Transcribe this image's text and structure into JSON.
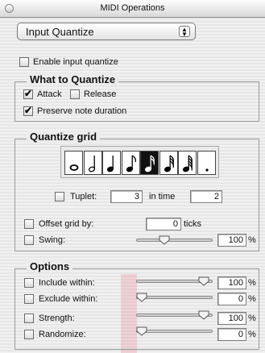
{
  "window": {
    "title": "MIDI Operations"
  },
  "mode_popup": {
    "value": "Input Quantize"
  },
  "enable": {
    "label": "Enable input quantize",
    "checked": false
  },
  "what_to_quantize": {
    "title": "What to Quantize",
    "attack": {
      "label": "Attack",
      "checked": true
    },
    "release": {
      "label": "Release",
      "checked": false
    },
    "preserve": {
      "label": "Preserve note duration",
      "checked": true
    }
  },
  "quantize_grid": {
    "title": "Quantize grid",
    "notes": [
      "whole-note-icon",
      "half-note-icon",
      "quarter-note-icon",
      "eighth-note-icon",
      "sixteenth-note-icon",
      "thirty-second-note-icon",
      "sixty-fourth-note-icon",
      "dot-icon"
    ],
    "selected_note": "sixteenth-note-icon",
    "tuplet": {
      "label": "Tuplet:",
      "checked": false,
      "value": "3",
      "in_time_label": "in time",
      "in_time_value": "2"
    },
    "offset": {
      "label": "Offset grid by:",
      "checked": false,
      "value": "0",
      "unit": "ticks"
    },
    "swing": {
      "label": "Swing:",
      "checked": false,
      "value": "100",
      "unit": "%",
      "level": 0.35
    }
  },
  "options": {
    "title": "Options",
    "include": {
      "label": "Include within:",
      "checked": false,
      "value": "100",
      "unit": "%",
      "level": 0.95
    },
    "exclude": {
      "label": "Exclude within:",
      "checked": false,
      "value": "0",
      "unit": "%",
      "level": 0.0
    },
    "strength": {
      "label": "Strength:",
      "checked": false,
      "value": "100",
      "unit": "%",
      "level": 0.95
    },
    "randomize": {
      "label": "Randomize:",
      "checked": false,
      "value": "0",
      "unit": "%",
      "level": 0.0
    }
  },
  "checkmark_glyph": "✔"
}
